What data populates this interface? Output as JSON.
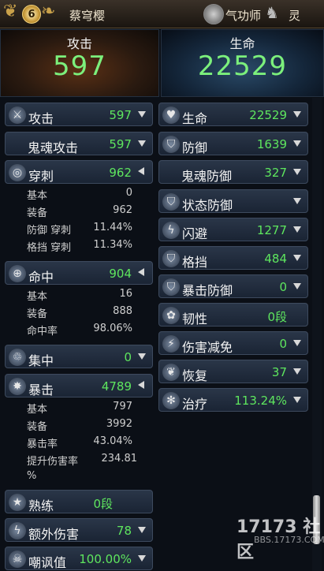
{
  "header": {
    "level": "6",
    "char_name": "蔡穹樱",
    "class_name": "气功师",
    "spirit_name": "灵"
  },
  "banners": {
    "attack": {
      "label": "攻击",
      "value": "597"
    },
    "hp": {
      "label": "生命",
      "value": "22529"
    }
  },
  "left": {
    "attack": {
      "label": "攻击",
      "value": "597"
    },
    "soul_attack": {
      "label": "鬼魂攻击",
      "value": "597"
    },
    "pierce": {
      "label": "穿刺",
      "value": "962",
      "subs": [
        {
          "label": "基本",
          "value": "0"
        },
        {
          "label": "装备",
          "value": "962"
        },
        {
          "label": "防御 穿刺",
          "value": "11.44%"
        },
        {
          "label": "格挡 穿刺",
          "value": "11.34%"
        }
      ]
    },
    "hit": {
      "label": "命中",
      "value": "904",
      "subs": [
        {
          "label": "基本",
          "value": "16"
        },
        {
          "label": "装备",
          "value": "888"
        },
        {
          "label": "命中率",
          "value": "98.06%"
        }
      ]
    },
    "focus": {
      "label": "集中",
      "value": "0"
    },
    "crit": {
      "label": "暴击",
      "value": "4789",
      "subs": [
        {
          "label": "基本",
          "value": "797"
        },
        {
          "label": "装备",
          "value": "3992"
        },
        {
          "label": "暴击率",
          "value": "43.04%"
        },
        {
          "label": "提升伤害率",
          "value": "234.81"
        },
        {
          "label": "%",
          "value": ""
        }
      ]
    },
    "mastery": {
      "label": "熟练",
      "value": "0段"
    },
    "extra_damage": {
      "label": "额外伤害",
      "value": "78"
    },
    "taunt": {
      "label": "嘲讽值",
      "value": "100.00%"
    }
  },
  "right": {
    "hp": {
      "label": "生命",
      "value": "22529"
    },
    "defense": {
      "label": "防御",
      "value": "1639"
    },
    "soul_defense": {
      "label": "鬼魂防御",
      "value": "327"
    },
    "status_defense": {
      "label": "状态防御",
      "value": ""
    },
    "evade": {
      "label": "闪避",
      "value": "1277"
    },
    "block": {
      "label": "格挡",
      "value": "484"
    },
    "crit_defense": {
      "label": "暴击防御",
      "value": "0"
    },
    "toughness": {
      "label": "韧性",
      "value": "0段"
    },
    "damage_reduction": {
      "label": "伤害减免",
      "value": "0"
    },
    "recovery": {
      "label": "恢复",
      "value": "37"
    },
    "heal": {
      "label": "治疗",
      "value": "113.24%"
    }
  },
  "watermark": {
    "main": "17173 社区",
    "sub": "BBS.17173.COM"
  },
  "icons": {
    "attack": "sword-icon",
    "pierce": "pierce-icon",
    "hit": "target-icon",
    "focus": "focus-icon",
    "crit": "burst-icon",
    "mastery": "star-icon",
    "extra_damage": "lightning-icon",
    "taunt": "skull-icon",
    "hp": "heart-icon",
    "defense": "shield-icon",
    "status_defense": "shield-icon",
    "evade": "lightning-icon",
    "block": "shield-icon",
    "crit_defense": "shield-icon",
    "toughness": "swirl-icon",
    "damage_reduction": "strike-icon",
    "recovery": "sprout-icon",
    "heal": "snowflake-icon"
  }
}
